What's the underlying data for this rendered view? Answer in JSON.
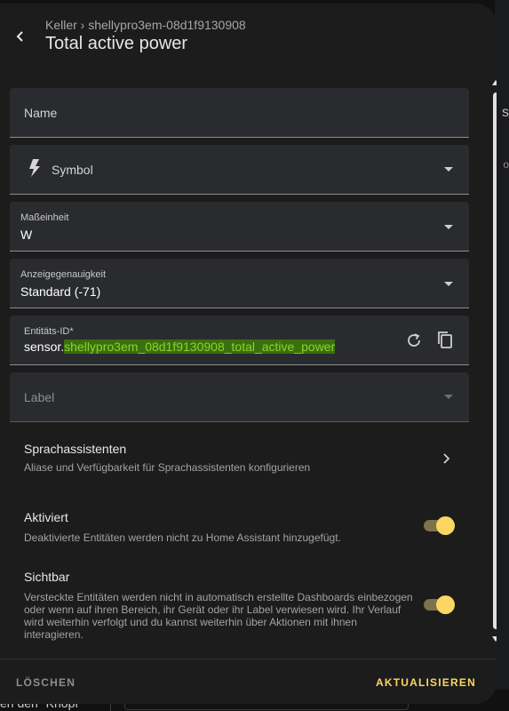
{
  "background": {
    "partial_text": "en den \"Knopf\""
  },
  "header": {
    "breadcrumb": "Keller › shellypro3em-08d1f9130908",
    "title": "Total active power"
  },
  "fields": {
    "name": {
      "label": "Name"
    },
    "symbol": {
      "label": "Symbol"
    },
    "unit": {
      "label": "Maßeinheit",
      "value": "W"
    },
    "precision": {
      "label": "Anzeigegenauigkeit",
      "value": "Standard (-71)"
    },
    "entity_id": {
      "label": "Entitäts-ID*",
      "prefix": "sensor.",
      "value": "shellypro3em_08d1f9130908_total_active_power"
    },
    "label": {
      "label": "Label"
    }
  },
  "voice": {
    "title": "Sprachassistenten",
    "subtitle": "Aliase und Verfügbarkeit für Sprachassistenten konfigurieren"
  },
  "enabled": {
    "title": "Aktiviert",
    "subtitle": "Deaktivierte Entitäten werden nicht zu Home Assistant hinzugefügt.",
    "on": true
  },
  "visible": {
    "title": "Sichtbar",
    "subtitle": "Versteckte Entitäten werden nicht in automatisch erstellte Dashboards einbezogen oder wenn auf ihren Bereich, ihr Gerät oder ihr Label verwiesen wird. Ihr Verlauf wird weiterhin verfolgt und du kannst weiterhin über Aktionen mit ihnen interagieren.",
    "on": true
  },
  "footer": {
    "delete_label": "LÖSCHEN",
    "update_label": "AKTUALISIEREN"
  },
  "colors": {
    "accent": "#fcd663",
    "highlight": "#3b6f0e"
  }
}
